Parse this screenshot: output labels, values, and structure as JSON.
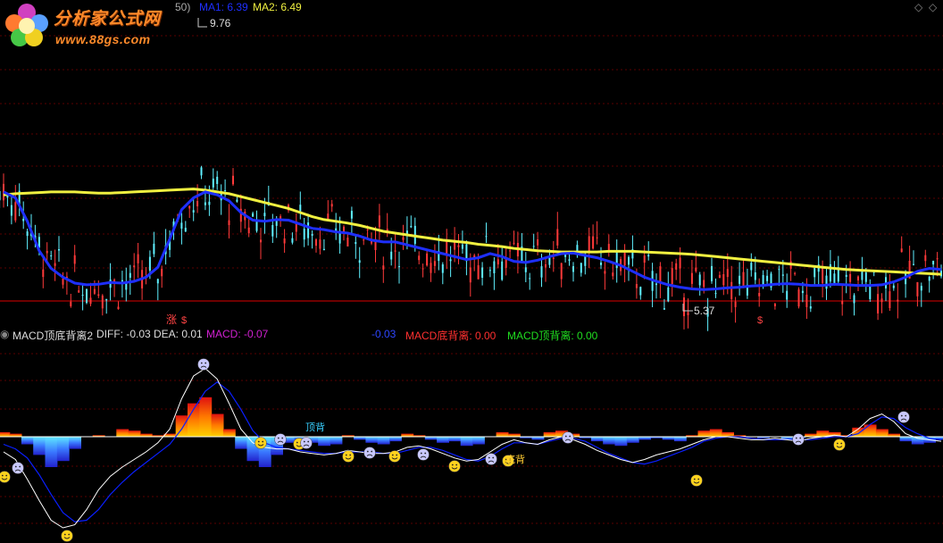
{
  "header": {
    "paren_fragment": "50)",
    "ma1_label": "MA1: 6.39",
    "ma2_label": "MA2: 6.49",
    "high_label": "9.76",
    "low_label": "5.37",
    "zhang_mark": "涨",
    "s_mark": "$"
  },
  "logo": {
    "title": "分析家公式网",
    "url": "www.88gs.com"
  },
  "macd_header": {
    "name": "MACD顶底背离2",
    "diff": "DIFF: -0.03",
    "dea": "DEA: 0.01",
    "macd": "MACD: -0.07",
    "extra": "-0.03",
    "bottom_div": "MACD底背离: 0.00",
    "top_div": "MACD顶背离: 0.00"
  },
  "colors": {
    "ma1": "#1e2fff",
    "ma2": "#f0f040",
    "diff": "#ffffff",
    "dea": "#0a1fff",
    "macd_label": "#d020d0",
    "bottom_div": "#ff3030",
    "top_div": "#20dd20",
    "up_candle": "#ff3a3a",
    "down_candle": "#5ff0ff"
  },
  "chart_data": [
    {
      "type": "line",
      "ma1": [
        6.9,
        6.8,
        6.4,
        5.9,
        5.6,
        5.45,
        5.35,
        5.32,
        5.33,
        5.36,
        5.35,
        5.38,
        5.45,
        5.62,
        6.1,
        6.6,
        6.8,
        6.9,
        6.85,
        6.75,
        6.55,
        6.42,
        6.4,
        6.43,
        6.42,
        6.35,
        6.28,
        6.26,
        6.22,
        6.2,
        6.15,
        6.08,
        6.05,
        6.05,
        6.0,
        5.95,
        5.9,
        5.85,
        5.8,
        5.75,
        5.78,
        5.85,
        5.8,
        5.72,
        5.7,
        5.74,
        5.8,
        5.85,
        5.86,
        5.82,
        5.78,
        5.72,
        5.65,
        5.55,
        5.45,
        5.38,
        5.32,
        5.28,
        5.25,
        5.24,
        5.25,
        5.27,
        5.28,
        5.3,
        5.31,
        5.33,
        5.34,
        5.33,
        5.31,
        5.31,
        5.33,
        5.32,
        5.31,
        5.31,
        5.32,
        5.37,
        5.45,
        5.55,
        5.6,
        5.58
      ],
      "ma2": [
        6.85,
        6.87,
        6.88,
        6.89,
        6.9,
        6.9,
        6.9,
        6.89,
        6.88,
        6.88,
        6.89,
        6.9,
        6.91,
        6.92,
        6.93,
        6.94,
        6.95,
        6.93,
        6.9,
        6.87,
        6.82,
        6.77,
        6.72,
        6.67,
        6.62,
        6.55,
        6.48,
        6.43,
        6.4,
        6.37,
        6.33,
        6.28,
        6.23,
        6.2,
        6.17,
        6.14,
        6.11,
        6.08,
        6.06,
        6.04,
        6.01,
        5.99,
        5.97,
        5.94,
        5.92,
        5.9,
        5.89,
        5.88,
        5.88,
        5.88,
        5.88,
        5.89,
        5.89,
        5.89,
        5.88,
        5.87,
        5.86,
        5.85,
        5.84,
        5.82,
        5.8,
        5.78,
        5.76,
        5.74,
        5.72,
        5.7,
        5.68,
        5.66,
        5.64,
        5.62,
        5.6,
        5.58,
        5.57,
        5.56,
        5.55,
        5.54,
        5.53,
        5.52,
        5.51,
        5.5
      ],
      "price_high": 9.76,
      "price_low": 5.37
    },
    {
      "type": "bar",
      "hist": [
        0.03,
        0.02,
        -0.05,
        -0.12,
        -0.2,
        -0.16,
        -0.08,
        0.0,
        0.01,
        0.0,
        0.05,
        0.04,
        0.02,
        0.01,
        0.02,
        0.14,
        0.22,
        0.26,
        0.15,
        0.05,
        -0.08,
        -0.16,
        -0.2,
        -0.12,
        -0.04,
        -0.02,
        -0.04,
        -0.06,
        -0.05,
        0.01,
        -0.02,
        -0.04,
        -0.05,
        -0.03,
        0.02,
        0.01,
        -0.02,
        -0.04,
        -0.03,
        -0.06,
        -0.05,
        0.0,
        0.03,
        0.02,
        -0.01,
        -0.02,
        0.03,
        0.04,
        0.02,
        -0.01,
        -0.03,
        -0.05,
        -0.06,
        -0.04,
        -0.02,
        -0.01,
        -0.02,
        -0.03,
        0.01,
        0.04,
        0.05,
        0.03,
        0.01,
        0.0,
        -0.01,
        0.0,
        -0.02,
        -0.01,
        0.02,
        0.04,
        0.03,
        0.01,
        0.06,
        0.08,
        0.05,
        0.02,
        -0.03,
        -0.05,
        -0.04,
        -0.02
      ],
      "diff": [
        -0.1,
        -0.15,
        -0.28,
        -0.42,
        -0.55,
        -0.6,
        -0.58,
        -0.48,
        -0.35,
        -0.26,
        -0.2,
        -0.15,
        -0.1,
        -0.04,
        0.05,
        0.25,
        0.4,
        0.45,
        0.38,
        0.22,
        0.05,
        -0.04,
        -0.07,
        -0.08,
        -0.08,
        -0.1,
        -0.11,
        -0.12,
        -0.11,
        -0.09,
        -0.1,
        -0.11,
        -0.11,
        -0.1,
        -0.07,
        -0.06,
        -0.08,
        -0.11,
        -0.14,
        -0.16,
        -0.15,
        -0.1,
        -0.05,
        -0.02,
        -0.04,
        -0.05,
        -0.02,
        0.0,
        -0.02,
        -0.05,
        -0.09,
        -0.12,
        -0.15,
        -0.17,
        -0.15,
        -0.12,
        -0.1,
        -0.08,
        -0.05,
        -0.02,
        0.0,
        0.0,
        -0.01,
        -0.02,
        -0.02,
        -0.01,
        -0.02,
        -0.03,
        -0.01,
        0.0,
        0.01,
        0.0,
        0.05,
        0.12,
        0.15,
        0.1,
        0.02,
        -0.01,
        -0.02,
        -0.03
      ],
      "dea": [
        -0.05,
        -0.08,
        -0.14,
        -0.25,
        -0.38,
        -0.5,
        -0.56,
        -0.55,
        -0.48,
        -0.38,
        -0.3,
        -0.23,
        -0.17,
        -0.11,
        -0.05,
        0.05,
        0.18,
        0.3,
        0.36,
        0.3,
        0.18,
        0.04,
        -0.04,
        -0.07,
        -0.08,
        -0.09,
        -0.1,
        -0.11,
        -0.11,
        -0.1,
        -0.1,
        -0.1,
        -0.11,
        -0.11,
        -0.09,
        -0.07,
        -0.07,
        -0.09,
        -0.12,
        -0.15,
        -0.16,
        -0.13,
        -0.08,
        -0.04,
        -0.04,
        -0.05,
        -0.03,
        -0.01,
        -0.01,
        -0.03,
        -0.07,
        -0.11,
        -0.14,
        -0.17,
        -0.18,
        -0.16,
        -0.13,
        -0.1,
        -0.07,
        -0.03,
        -0.01,
        0.0,
        0.0,
        -0.01,
        -0.02,
        -0.02,
        -0.02,
        -0.02,
        -0.02,
        -0.01,
        0.0,
        0.0,
        0.02,
        0.08,
        0.13,
        0.12,
        0.06,
        0.02,
        -0.01,
        -0.02
      ]
    }
  ]
}
